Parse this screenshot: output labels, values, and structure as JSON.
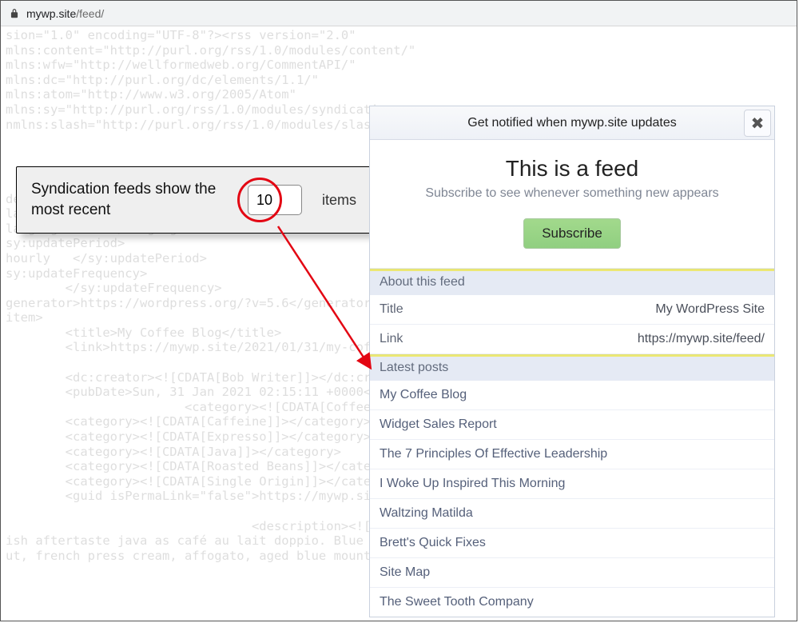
{
  "urlbar": {
    "host": "mywp.site",
    "path": "/feed/"
  },
  "bg_xml": "sion=\"1.0\" encoding=\"UTF-8\"?><rss version=\"2.0\"\nmlns:content=\"http://purl.org/rss/1.0/modules/content/\"\nmlns:wfw=\"http://wellformedweb.org/CommentAPI/\"\nmlns:dc=\"http://purl.org/dc/elements/1.1/\"\nmlns:atom=\"http://www.w3.org/2005/Atom\"\nmlns:sy=\"http://purl.org/rss/1.0/modules/syndicati\nnmlns:slash=\"http://purl.org/rss/1.0/modules/slash/\"\n\n\n\n\ndescription>My Tagline Goes Here</description>\nlastBuildDate>Sun, 31 Jan 2021 11:40:44 +000</last\nlanguage>en-US</language>\nsy:updatePeriod>\nhourly   </sy:updatePeriod>\nsy:updateFrequency>\n        </sy:updateFrequency>\ngenerator>https://wordpress.org/?v=5.6</generator>\nitem>\n        <title>My Coffee Blog</title>\n        <link>https://mywp.site/2021/01/31/my-coffe\n\n        <dc:creator><![CDATA[Bob Writer]]></dc:crea\n        <pubDate>Sun, 31 Jan 2021 02:15:11 +0000</p\n                        <category><![CDATA[Coffee]]>\n        <category><![CDATA[Caffeine]]></category>\n        <category><![CDATA[Expresso]]></category>\n        <category><![CDATA[Java]]></category>\n        <category><![CDATA[Roasted Beans]]></catego\n        <category><![CDATA[Single Origin]]></catego\n        <guid isPermaLink=\"false\">https://mywp.site/\n\n                                 <description><![CDAT                                    ization\nish aftertaste java as café au lait doppio. Blue me                                    r fla\nut, french press cream, affogato, aged blue mountain acerbic sweet con panna. Medium, cinnamon, body",
  "settings": {
    "label": "Syndication feeds show the most recent",
    "value": "10",
    "suffix": "items"
  },
  "panel": {
    "header": "Get notified when mywp.site updates",
    "closeGlyph": "✖",
    "intro_title": "This is a feed",
    "intro_sub": "Subscribe to see whenever something new appears",
    "subscribe": "Subscribe",
    "section_about": "About this feed",
    "about_rows": [
      {
        "label": "Title",
        "value": "My WordPress Site"
      },
      {
        "label": "Link",
        "value": "https://mywp.site/feed/"
      }
    ],
    "section_posts": "Latest posts",
    "posts": [
      "My Coffee Blog",
      "Widget Sales Report",
      "The 7 Principles Of Effective Leadership",
      "I Woke Up Inspired This Morning",
      "Waltzing Matilda",
      "Brett's Quick Fixes",
      "Site Map",
      "The Sweet Tooth Company"
    ]
  }
}
